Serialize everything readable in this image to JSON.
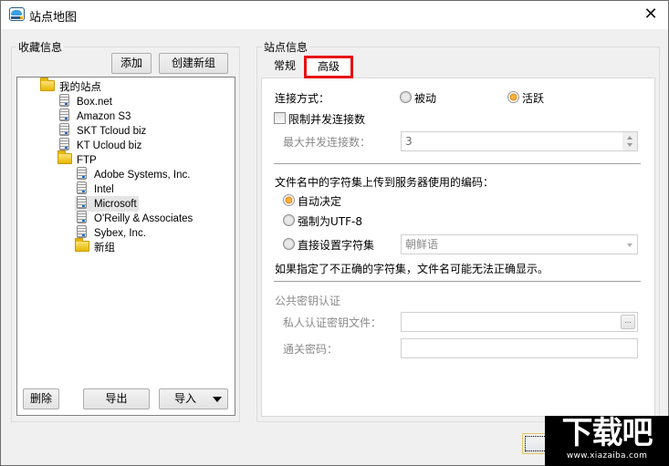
{
  "window": {
    "title": "站点地图",
    "close_glyph": "✕"
  },
  "favorites": {
    "group_label": "收藏信息",
    "add_label": "添加",
    "new_group_label": "创建新组",
    "tree": [
      {
        "label": "我的站点",
        "type": "folder",
        "level": 0
      },
      {
        "label": "Box.net",
        "type": "site",
        "level": 1
      },
      {
        "label": "Amazon S3",
        "type": "site",
        "level": 1
      },
      {
        "label": "SKT Tcloud biz",
        "type": "site",
        "level": 1
      },
      {
        "label": "KT Ucloud biz",
        "type": "site",
        "level": 1
      },
      {
        "label": "FTP",
        "type": "folder",
        "level": 1
      },
      {
        "label": "Adobe Systems, Inc.",
        "type": "site",
        "level": 2
      },
      {
        "label": "Intel",
        "type": "site",
        "level": 2
      },
      {
        "label": "Microsoft",
        "type": "site",
        "level": 2,
        "selected": true
      },
      {
        "label": "O'Reilly & Associates",
        "type": "site",
        "level": 2
      },
      {
        "label": "Sybex, Inc.",
        "type": "site",
        "level": 2
      },
      {
        "label": "新组",
        "type": "folder",
        "level": 2
      }
    ],
    "delete_label": "删除",
    "export_label": "导出",
    "import_label": "导入"
  },
  "site_info": {
    "group_label": "站点信息",
    "tabs": [
      {
        "label": "常规",
        "active": false
      },
      {
        "label": "高级",
        "active": true
      }
    ],
    "connection_mode_label": "连接方式：",
    "passive_label": "被动",
    "active_label": "活跃",
    "connection_mode_value": "活跃",
    "limit_concurrent_label": "限制并发连接数",
    "limit_concurrent_checked": false,
    "max_concurrent_label": "最大并发连接数：",
    "max_concurrent_value": "3",
    "charset_heading": "文件名中的字符集上传到服务器使用的编码：",
    "charset_auto_label": "自动决定",
    "charset_utf8_label": "强制为UTF-8",
    "charset_direct_label": "直接设置字符集",
    "charset_selected_option": "自动决定",
    "charset_combo_value": "朝鲜语",
    "charset_warning": "如果指定了不正确的字符集，文件名可能无法正确显示。",
    "pubkey_heading": "公共密钥认证",
    "private_key_label": "私人认证密钥文件：",
    "private_key_value": "",
    "browse_label": "...",
    "passphrase_label": "通关密码：",
    "passphrase_value": ""
  },
  "watermark": {
    "big_text": "下载吧",
    "small_text": "www.xiazaiba.com"
  }
}
